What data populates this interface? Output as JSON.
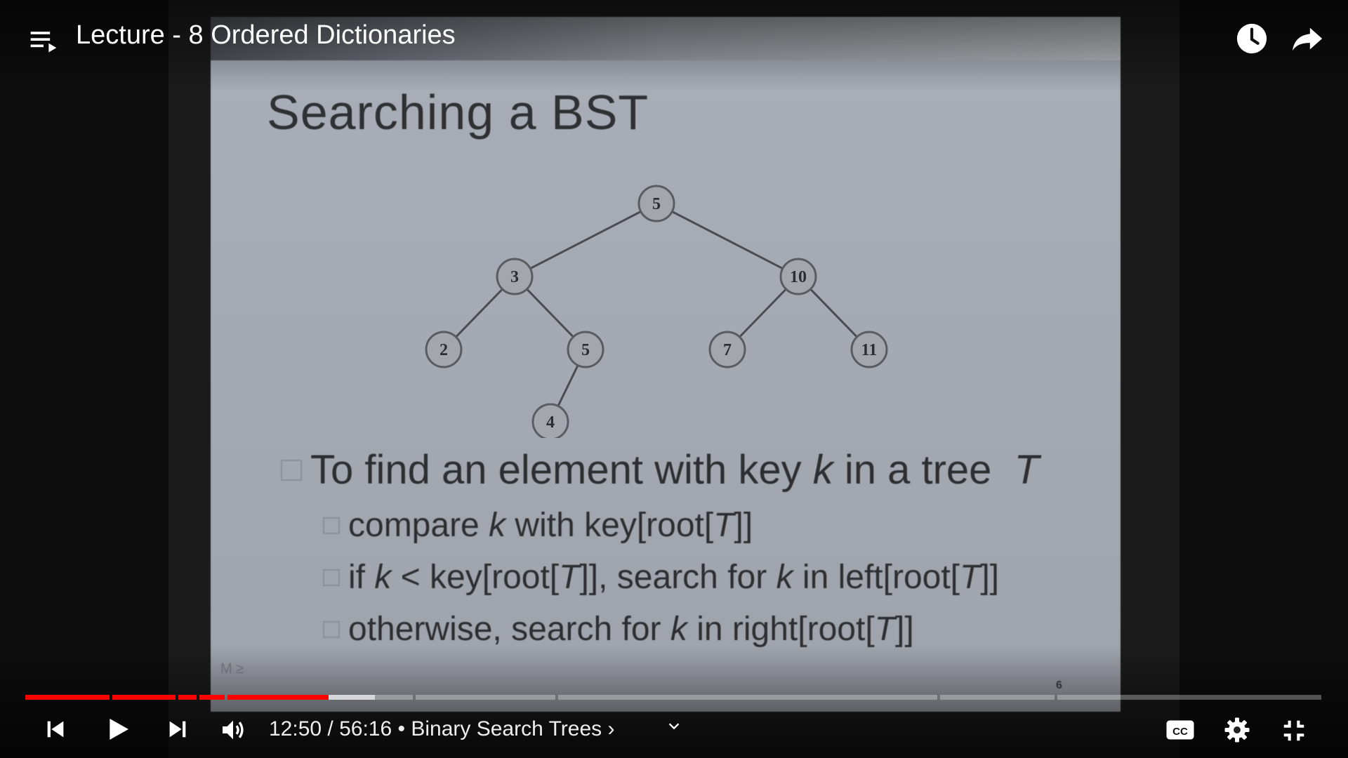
{
  "player": {
    "title": "Lecture - 8 Ordered Dictionaries",
    "time_current": "12:50",
    "time_separator": " / ",
    "time_total": "56:16",
    "chapter_separator": " • ",
    "chapter_title": "Binary Search Trees",
    "chapter_chevron": "›",
    "progress": {
      "played_fraction": 0.234,
      "buffered_fraction": 0.27,
      "chapter_marks": [
        0.066,
        0.117,
        0.133,
        0.155,
        0.3,
        0.41,
        0.705,
        0.795
      ]
    },
    "accent_color": "#ff0000",
    "icons": {
      "playlist": "playlist-icon",
      "watch_later": "clock-icon",
      "share": "share-arrow-icon",
      "previous": "skip-previous-icon",
      "play": "play-icon",
      "next": "skip-next-icon",
      "volume": "volume-icon",
      "chapter_dropdown": "chevron-down-icon",
      "captions": "cc-icon",
      "settings": "gear-icon",
      "exit_fullscreen": "exit-fullscreen-icon"
    }
  },
  "slide": {
    "title": "Searching a BST",
    "tree": {
      "nodes": [
        "5",
        "3",
        "10",
        "2",
        "5",
        "7",
        "11",
        "4"
      ],
      "edges": [
        [
          0,
          1
        ],
        [
          0,
          2
        ],
        [
          1,
          3
        ],
        [
          1,
          4
        ],
        [
          2,
          5
        ],
        [
          2,
          6
        ],
        [
          4,
          7
        ]
      ]
    },
    "bullets": {
      "main": {
        "pre": "To find an element with key ",
        "var1": "k",
        "mid": " in a tree ",
        "var2": "T"
      },
      "sub1": {
        "pre": "compare ",
        "var1": "k",
        "mid": " with key[root[",
        "var2": "T",
        "post": "]]"
      },
      "sub2": {
        "pre": "if ",
        "var1": "k",
        "mid": " < key[root[",
        "var2": "T",
        "mid2": "]], search for ",
        "var3": "k",
        "mid3": " in left[root[",
        "var4": "T",
        "post": "]]"
      },
      "sub3": {
        "pre": "otherwise, search for ",
        "var1": "k",
        "mid": " in right[root[",
        "var2": "T",
        "post": "]]"
      }
    },
    "footer_left": "M ≥",
    "page_number": "6"
  }
}
